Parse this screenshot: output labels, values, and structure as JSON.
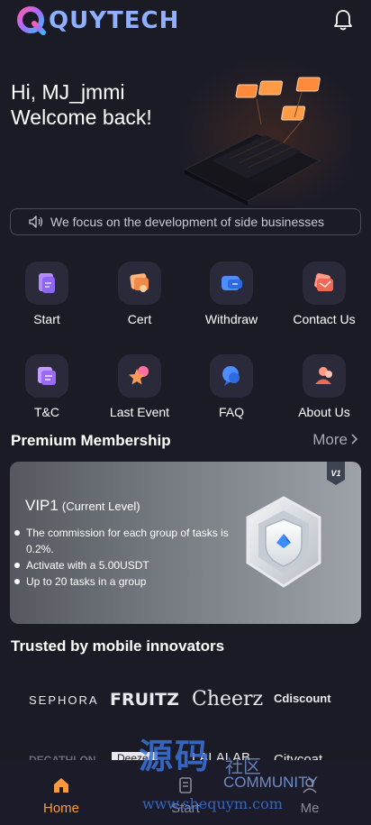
{
  "app": {
    "brand": "QUYTECH",
    "accent": "#8fb0ff"
  },
  "header": {
    "notification_icon": "bell-icon"
  },
  "hero": {
    "greeting_line1": "Hi, MJ_jmmi",
    "greeting_line2": "Welcome back!"
  },
  "notice": {
    "icon": "speaker-icon",
    "text": "We focus on the development of side businesses"
  },
  "menu": [
    {
      "label": "Start",
      "icon": "document-icon"
    },
    {
      "label": "Cert",
      "icon": "certificate-icon"
    },
    {
      "label": "Withdraw",
      "icon": "wallet-icon"
    },
    {
      "label": "Contact Us",
      "icon": "mail-icon"
    },
    {
      "label": "T&C",
      "icon": "terms-icon"
    },
    {
      "label": "Last Event",
      "icon": "star-icon"
    },
    {
      "label": "FAQ",
      "icon": "question-icon"
    },
    {
      "label": "About Us",
      "icon": "people-icon"
    }
  ],
  "premium": {
    "title": "Premium Membership",
    "more_label": "More",
    "vip_name": "VIP1",
    "vip_level": "(Current Level)",
    "tag": "V1",
    "benefits": [
      "The commission for each group of tasks is 0.2%.",
      "Activate with a 5.00USDT",
      "Up to 20 tasks in a group"
    ]
  },
  "trusted": {
    "title": "Trusted by mobile innovators",
    "brands": [
      "SEPHORA",
      "FRUITZ",
      "Cheerz",
      "Cdiscount",
      "DECATHLON",
      "Deezer",
      "LALALAB.",
      "Citycoat"
    ]
  },
  "bottom_nav": [
    {
      "label": "Home",
      "icon": "home-icon",
      "active": true
    },
    {
      "label": "Start",
      "icon": "document-icon",
      "active": false
    },
    {
      "label": "Me",
      "icon": "user-icon",
      "active": false
    }
  ],
  "watermark": {
    "line1": "源码",
    "line2": "社区",
    "line3": "COMMUNITY",
    "url": "www.shequym.com"
  }
}
